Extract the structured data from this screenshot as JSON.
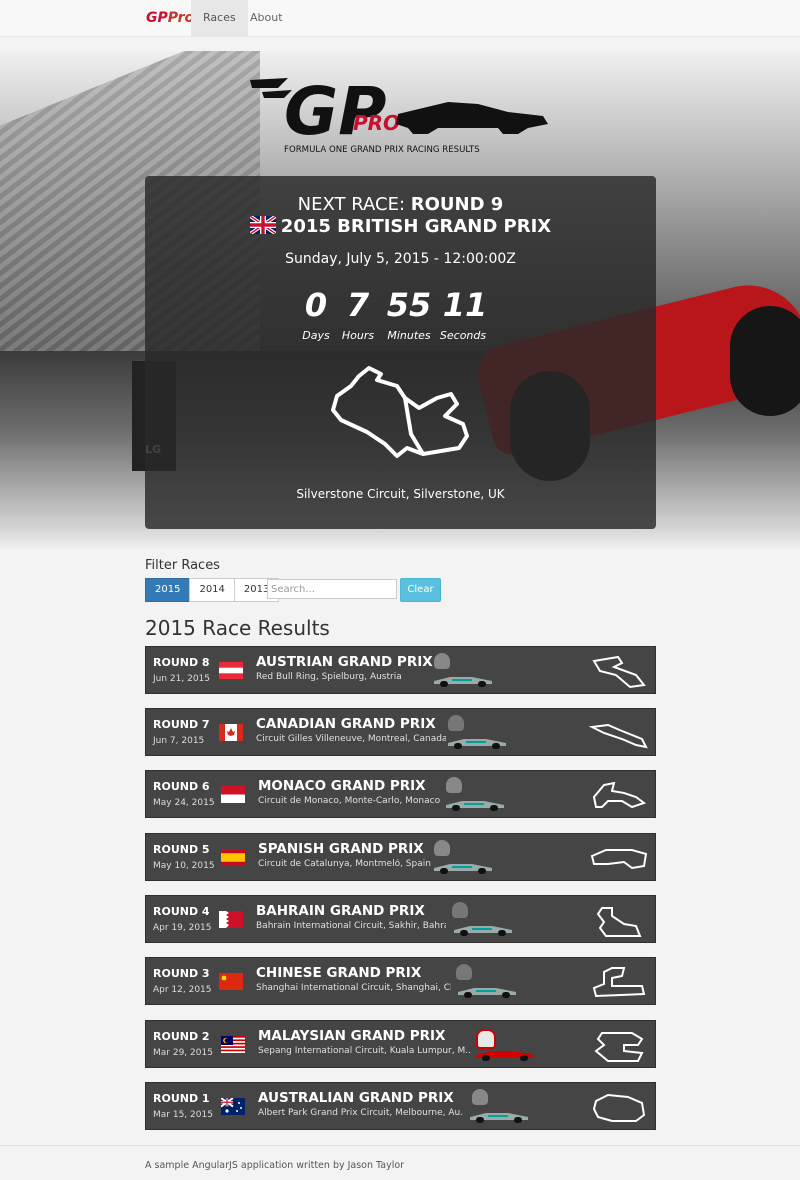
{
  "nav": {
    "brand_gp": "GP",
    "brand_pro": "Pro",
    "races": "Races",
    "about": "About"
  },
  "logo": {
    "gp": "GP",
    "pro": "PRO",
    "tagline": "FORMULA ONE GRAND PRIX RACING RESULTS"
  },
  "next_race": {
    "label": "NEXT RACE:",
    "round": "ROUND 9",
    "title": "2015 BRITISH GRAND PRIX",
    "date": "Sunday, July 5, 2015 - 12:00:00Z",
    "countdown": {
      "days": "0",
      "days_label": "Days",
      "hours": "7",
      "hours_label": "Hours",
      "minutes": "55",
      "minutes_label": "Minutes",
      "seconds": "11",
      "seconds_label": "Seconds"
    },
    "circuit": "Silverstone Circuit, Silverstone, UK"
  },
  "filter": {
    "title": "Filter Races",
    "years": [
      "2015",
      "2014",
      "2013"
    ],
    "selected_year": "2015",
    "search_placeholder": "Search...",
    "clear": "Clear"
  },
  "results_title": "2015 Race Results",
  "races": [
    {
      "round": "ROUND 8",
      "date": "Jun 21, 2015",
      "name": "AUSTRIAN GRAND PRIX",
      "circuit": "Red Bull Ring, Spielburg, Austria",
      "flag": "austria-flag",
      "winner_team": "mercedes"
    },
    {
      "round": "ROUND 7",
      "date": "Jun 7, 2015",
      "name": "CANADIAN GRAND PRIX",
      "circuit": "Circuit Gilles Villeneuve, Montreal, Canada",
      "flag": "canada-flag",
      "winner_team": "mercedes"
    },
    {
      "round": "ROUND 6",
      "date": "May 24, 2015",
      "name": "MONACO GRAND PRIX",
      "circuit": "Circuit de Monaco, Monte-Carlo, Monaco",
      "flag": "monaco-flag",
      "winner_team": "mercedes"
    },
    {
      "round": "ROUND 5",
      "date": "May 10, 2015",
      "name": "SPANISH GRAND PRIX",
      "circuit": "Circuit de Catalunya, Montmeló, Spain",
      "flag": "spain-flag",
      "winner_team": "mercedes"
    },
    {
      "round": "ROUND 4",
      "date": "Apr 19, 2015",
      "name": "BAHRAIN GRAND PRIX",
      "circuit": "Bahrain International Circuit, Sakhir, Bahrai",
      "flag": "bahrain-flag",
      "winner_team": "mercedes"
    },
    {
      "round": "ROUND 3",
      "date": "Apr 12, 2015",
      "name": "CHINESE GRAND PRIX",
      "circuit": "Shanghai International Circuit, Shanghai, Chi",
      "flag": "china-flag",
      "winner_team": "mercedes"
    },
    {
      "round": "ROUND 2",
      "date": "Mar 29, 2015",
      "name": "MALAYSIAN GRAND PRIX",
      "circuit": "Sepang International Circuit, Kuala Lumpur, M...",
      "flag": "malaysia-flag",
      "winner_team": "ferrari"
    },
    {
      "round": "ROUND 1",
      "date": "Mar 15, 2015",
      "name": "AUSTRALIAN GRAND PRIX",
      "circuit": "Albert Park Grand Prix Circuit, Melbourne, Au...",
      "flag": "australia-flag",
      "winner_team": "mercedes"
    }
  ],
  "footer": "A sample AngularJS application written by Jason Taylor",
  "colors": {
    "brand_red": "#c8102e",
    "active_blue": "#337ab7",
    "clear_cyan": "#5bc0de",
    "row_bg": "#454545",
    "mercedes_teal": "#00a19c",
    "ferrari_red": "#d40000"
  }
}
